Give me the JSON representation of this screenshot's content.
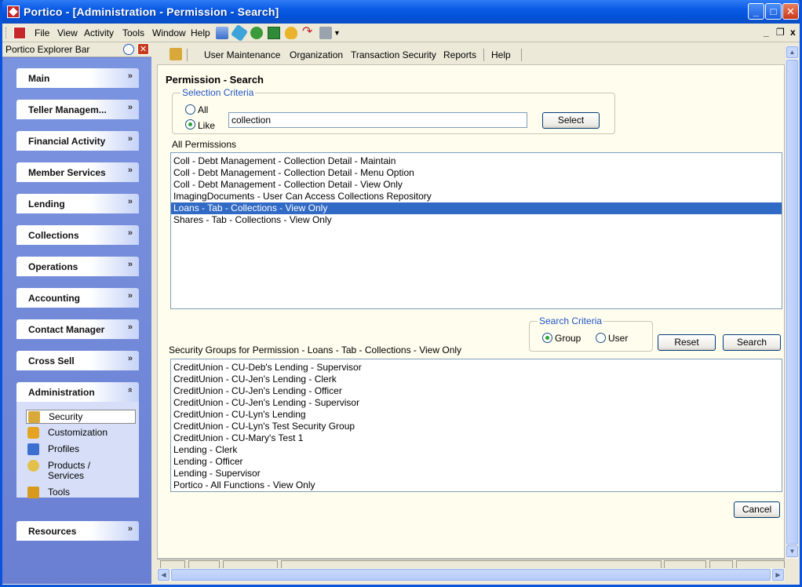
{
  "window": {
    "title": "Portico - [Administration - Permission - Search]"
  },
  "menu": [
    "File",
    "View",
    "Activity",
    "Tools",
    "Window",
    "Help"
  ],
  "explorer": {
    "title": "Portico Explorer Bar",
    "groups": [
      "Main",
      "Teller Managem...",
      "Financial Activity",
      "Member Services",
      "Lending",
      "Collections",
      "Operations",
      "Accounting",
      "Contact Manager",
      "Cross Sell",
      "Administration",
      "Resources"
    ],
    "admin_items": [
      "Security",
      "Customization",
      "Profiles",
      "Products / Services",
      "Tools"
    ],
    "selected_admin_item": "Security"
  },
  "subtoolbar": [
    "User Maintenance",
    "Organization",
    "Transaction Security",
    "Reports",
    "Help"
  ],
  "page": {
    "title": "Permission - Search",
    "selection_criteria": {
      "legend": "Selection Criteria",
      "option_all": "All",
      "option_like": "Like",
      "selected": "Like",
      "value": "collection",
      "select_button": "Select"
    },
    "all_permissions_label": "All Permissions",
    "permissions": [
      "Coll - Debt Management - Collection Detail - Maintain",
      "Coll - Debt Management - Collection Detail - Menu Option",
      "Coll - Debt Management - Collection Detail - View Only",
      "ImagingDocuments - User Can Access Collections Repository",
      "Loans - Tab - Collections - View Only",
      "Shares - Tab - Collections - View Only"
    ],
    "selected_permission_index": 4,
    "search_criteria": {
      "legend": "Search Criteria",
      "option_group": "Group",
      "option_user": "User",
      "selected": "Group"
    },
    "reset_button": "Reset",
    "search_button": "Search",
    "groups_label": "Security Groups for Permission - Loans - Tab - Collections - View Only",
    "security_groups": [
      "CreditUnion - CU-Deb's Lending - Supervisor",
      "CreditUnion - CU-Jen's Lending - Clerk",
      "CreditUnion - CU-Jen's Lending - Officer",
      "CreditUnion - CU-Jen's Lending - Supervisor",
      "CreditUnion - CU-Lyn's Lending",
      "CreditUnion - CU-Lyn's Test Security Group",
      "CreditUnion - CU-Mary's Test 1",
      "Lending - Clerk",
      "Lending - Officer",
      "Lending - Supervisor",
      "Portico - All Functions - View Only"
    ],
    "cancel_button": "Cancel"
  },
  "colors": {
    "selection": "#316ac5",
    "titlebar": "#0a5ae6",
    "explorer": "#6f86d8",
    "legend": "#2255c4"
  }
}
